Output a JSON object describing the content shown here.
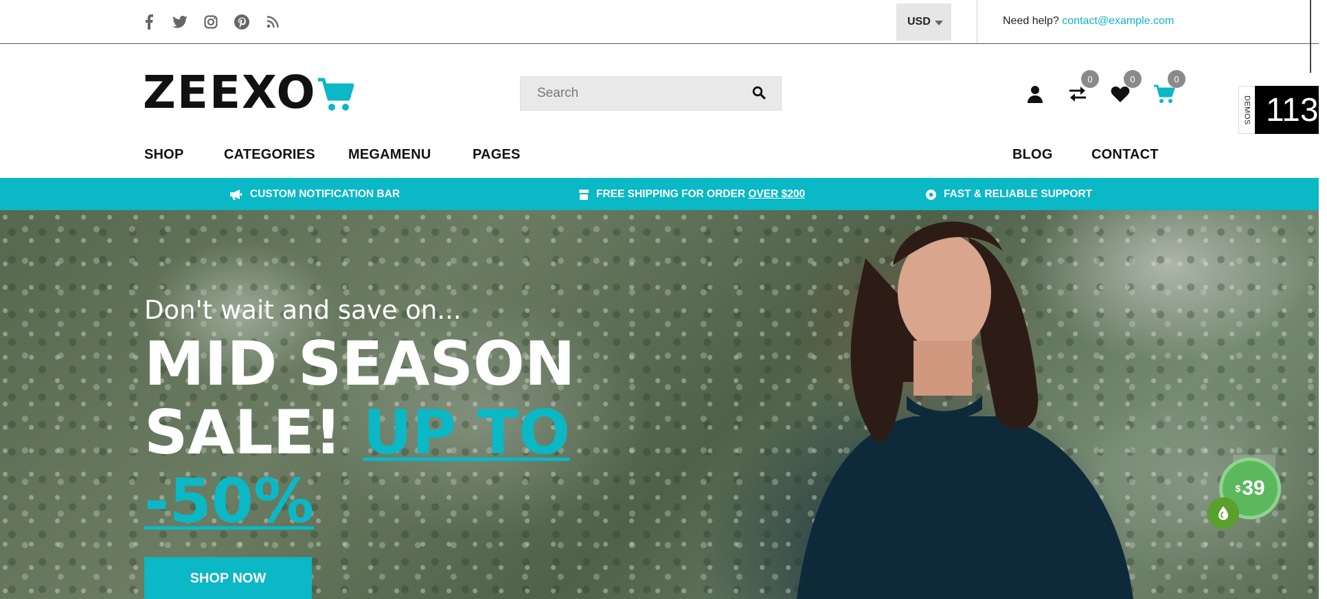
{
  "topbar": {
    "social_icons": [
      "facebook-icon",
      "twitter-icon",
      "instagram-icon",
      "pinterest-icon",
      "rss-icon"
    ],
    "currency": "USD",
    "help_label": "Need help?",
    "help_email": "contact@example.com"
  },
  "header": {
    "logo_text": "ZEEXO",
    "search_placeholder": "Search",
    "compare_count": "0",
    "wishlist_count": "0",
    "cart_count": "0"
  },
  "nav": {
    "left": [
      "SHOP",
      "CATEGORIES",
      "MEGAMENU",
      "PAGES"
    ],
    "right": [
      "BLOG",
      "CONTACT"
    ]
  },
  "demos": {
    "tab_label": "DEMOS",
    "count": "113"
  },
  "notification_bar": {
    "item1": "CUSTOM NOTIFICATION BAR",
    "item2_prefix": "FREE SHIPPING FOR ORDER ",
    "item2_link": "OVER $200",
    "item3": "FAST & RELIABLE SUPPORT"
  },
  "hero": {
    "subtitle": "Don't wait and save on...",
    "title_line1": "MID SEASON",
    "title_line2": "SALE!",
    "title_accent1": "UP TO",
    "title_accent2": "-50%",
    "cta": "SHOP NOW"
  },
  "floating": {
    "price_currency": "$",
    "price_value": "39"
  },
  "colors": {
    "accent": "#0ab8c6",
    "badge": "#8a8a8a",
    "price_green": "#5cb85c"
  }
}
